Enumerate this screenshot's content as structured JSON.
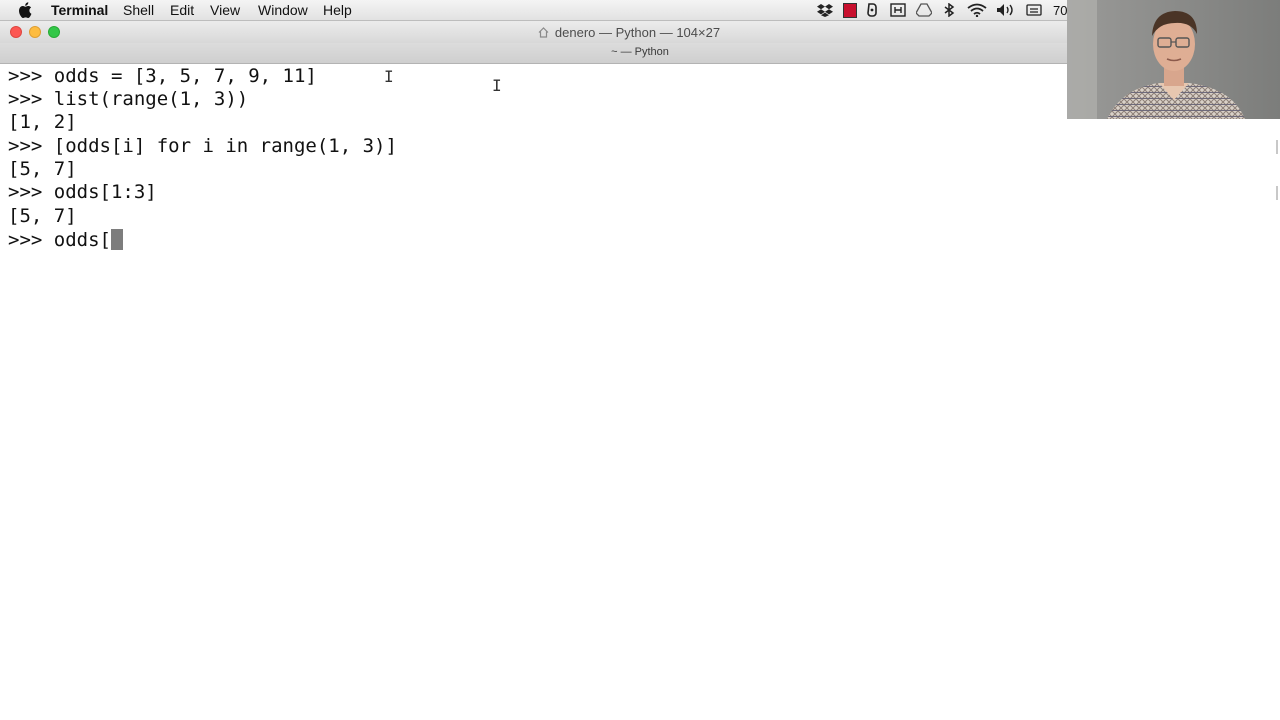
{
  "menubar": {
    "apple_icon": "apple-icon",
    "items": [
      "Terminal",
      "Shell",
      "Edit",
      "View",
      "Window",
      "Help"
    ],
    "status_icons": [
      "dropbox-icon",
      "red-square-icon",
      "evernote-icon",
      "frame-icon",
      "drive-icon",
      "bluetooth-icon",
      "wifi-icon",
      "volume-icon",
      "keyboard-icon"
    ],
    "clock_partial": "70"
  },
  "window": {
    "title": "denero — Python — 104×27",
    "tab_title": "~ — Python",
    "accent_colors": {
      "close": "#fc5753",
      "minimize": "#fdbc40",
      "zoom": "#33c748"
    }
  },
  "terminal": {
    "lines": [
      ">>> odds = [3, 5, 7, 9, 11]",
      ">>> list(range(1, 3))",
      "[1, 2]",
      ">>> [odds[i] for i in range(1, 3)]",
      "[5, 7]",
      ">>> odds[1:3]",
      "[5, 7]"
    ],
    "current_input": ">>> odds["
  }
}
